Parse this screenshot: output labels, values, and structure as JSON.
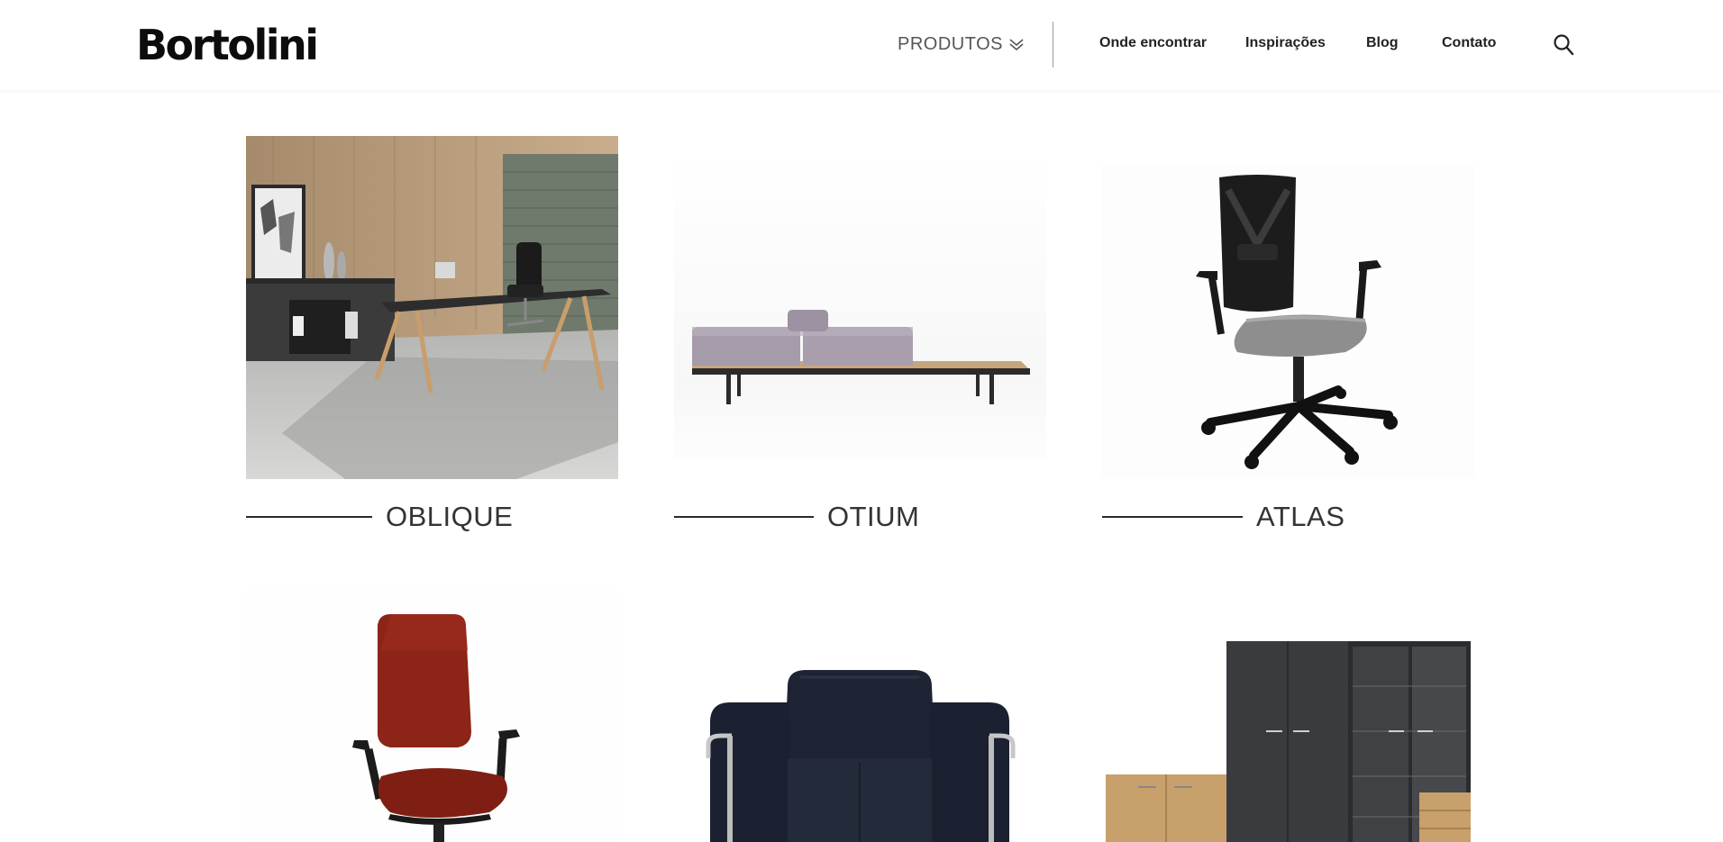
{
  "header": {
    "logo": "Bortolini",
    "nav": {
      "produtos": "PRODUTOS",
      "onde_encontrar": "Onde encontrar",
      "inspiracoes": "Inspirações",
      "blog": "Blog",
      "contato": "Contato"
    }
  },
  "products": [
    {
      "name": "OBLIQUE"
    },
    {
      "name": "OTIUM"
    },
    {
      "name": "ATLAS"
    }
  ],
  "colors": {
    "text_dark": "#1a1a1a",
    "nav_gray": "#555555",
    "divider": "#9a9a9a",
    "accent_red": "#8c2418"
  }
}
